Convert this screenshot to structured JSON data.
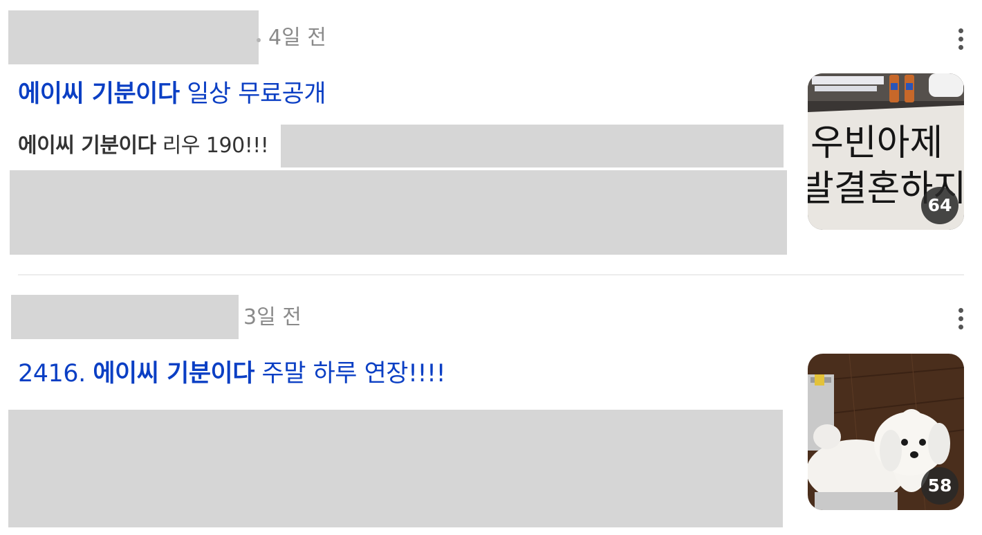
{
  "colors": {
    "title_link": "#0b3fc4",
    "date_text": "#8a8a8a",
    "redaction": "#d6d6d6",
    "divider": "#ececec"
  },
  "posts": [
    {
      "date": "4일 전",
      "title_highlight": "에이씨 기분이다",
      "title_rest": " 일상 무료공개",
      "snippet_highlight": "에이씨 기분이다",
      "snippet_rest": " 리우 190!!!",
      "thumbnail_count": "64",
      "thumbnail_text_line1": "우빈아제",
      "thumbnail_text_line2": "발결혼하지",
      "more_icon": "more-vertical-icon"
    },
    {
      "date": "3일 전",
      "title_prefix": "2416. ",
      "title_highlight": "에이씨 기분이다",
      "title_rest": " 주말 하루 연장!!!!",
      "thumbnail_count": "58",
      "more_icon": "more-vertical-icon"
    }
  ]
}
